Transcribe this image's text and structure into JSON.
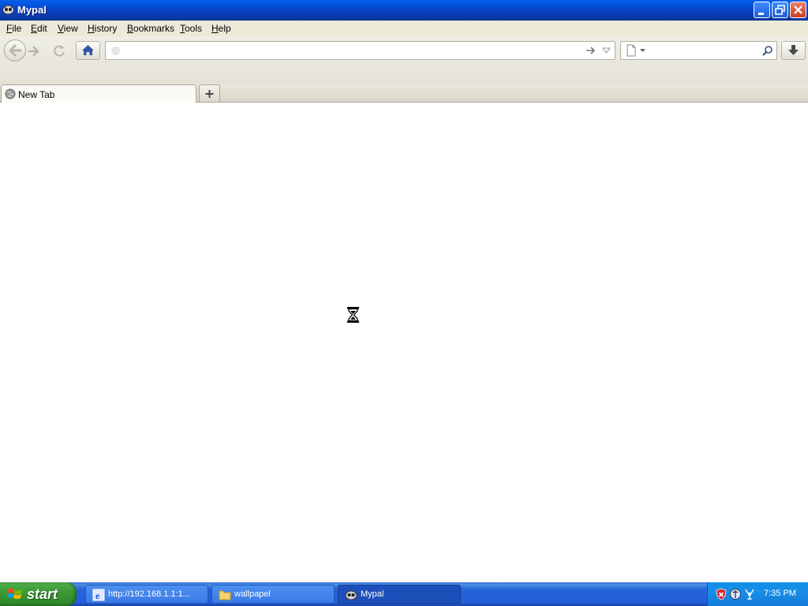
{
  "window": {
    "title": "Mypal",
    "icon": "mypal-app-icon",
    "controls": [
      "minimize-icon",
      "restore-icon",
      "close-icon"
    ]
  },
  "menu": {
    "items": [
      "File",
      "Edit",
      "View",
      "History",
      "Bookmarks",
      "Tools",
      "Help"
    ]
  },
  "toolbar": {
    "buttons": [
      "back-arrow-icon",
      "forward-arrow-icon",
      "reload-icon",
      "home-icon",
      "download-arrow-icon"
    ],
    "url_value": "",
    "url_placeholder": "",
    "search_value": "",
    "search_placeholder": ""
  },
  "tabs": [
    {
      "label": "New Tab",
      "icon": "globe-icon"
    }
  ],
  "content": {
    "state": "loading",
    "cursor": "hourglass-icon"
  },
  "taskbar": {
    "start_label": "start",
    "items": [
      {
        "label": "http://192.168.1.1:1...",
        "icon": "ie-icon",
        "active": false
      },
      {
        "label": "wallpapel",
        "icon": "folder-icon",
        "active": false
      },
      {
        "label": "Mypal",
        "icon": "mypal-app-icon",
        "active": true
      }
    ],
    "clock": "7:35 PM"
  },
  "colors": {
    "titlebar": "#0a3fbf",
    "taskbar": "#245edb",
    "start": "#3c9a36",
    "chrome": "#ece9d8"
  }
}
